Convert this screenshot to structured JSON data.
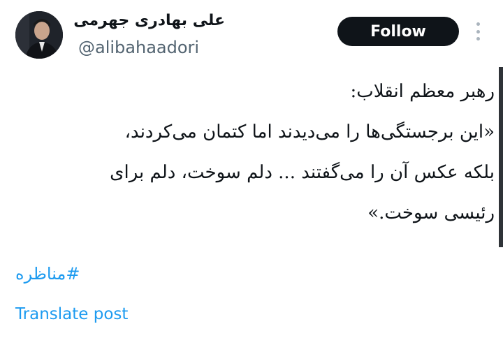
{
  "author": {
    "display_name": "علی بهادری جهرمی",
    "handle": "@alibahaadori",
    "avatar_icon": "person-portrait-icon"
  },
  "header": {
    "follow_label": "Follow",
    "more_icon": "more-vertical-icon"
  },
  "post": {
    "lines": [
      "رهبر معظم انقلاب:",
      "«این برجستگی‌ها را می‌دیدند اما کتمان می‌کردند،",
      "بلکه عکس آن را می‌گفتند ... دلم سوخت، دلم برای",
      "رئیسی سوخت.»"
    ],
    "hashtag": "#مناظره",
    "translate_label": "Translate post"
  },
  "colors": {
    "accent": "#1d9bf0",
    "text": "#0f1419",
    "secondary": "#536471",
    "button_bg": "#0f1419"
  }
}
